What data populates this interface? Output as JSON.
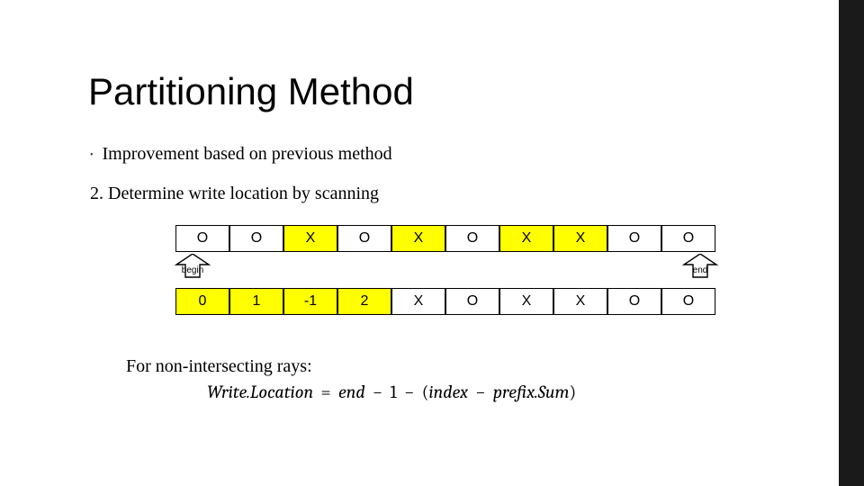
{
  "title": "Partitioning Method",
  "bullet_text": "Improvement based on previous method",
  "num_text": "2. Determine write location by scanning",
  "row1": [
    "O",
    "O",
    "X",
    "O",
    "X",
    "O",
    "X",
    "X",
    "O",
    "O"
  ],
  "row1_yellow": [
    false,
    false,
    true,
    false,
    true,
    false,
    true,
    true,
    false,
    false
  ],
  "row2": [
    "0",
    "1",
    "-1",
    "2",
    "X",
    "O",
    "X",
    "X",
    "O",
    "O"
  ],
  "row2_yellow": [
    true,
    true,
    true,
    true,
    false,
    false,
    false,
    false,
    false,
    false
  ],
  "label_begin": "begin",
  "label_end": "end",
  "formula_lead": "For non-intersecting rays:",
  "formula": {
    "lhs": "Write.Location",
    "rhs1": "end",
    "rhs2": "1",
    "rhs3a": "index",
    "rhs3b": "prefix.Sum"
  }
}
